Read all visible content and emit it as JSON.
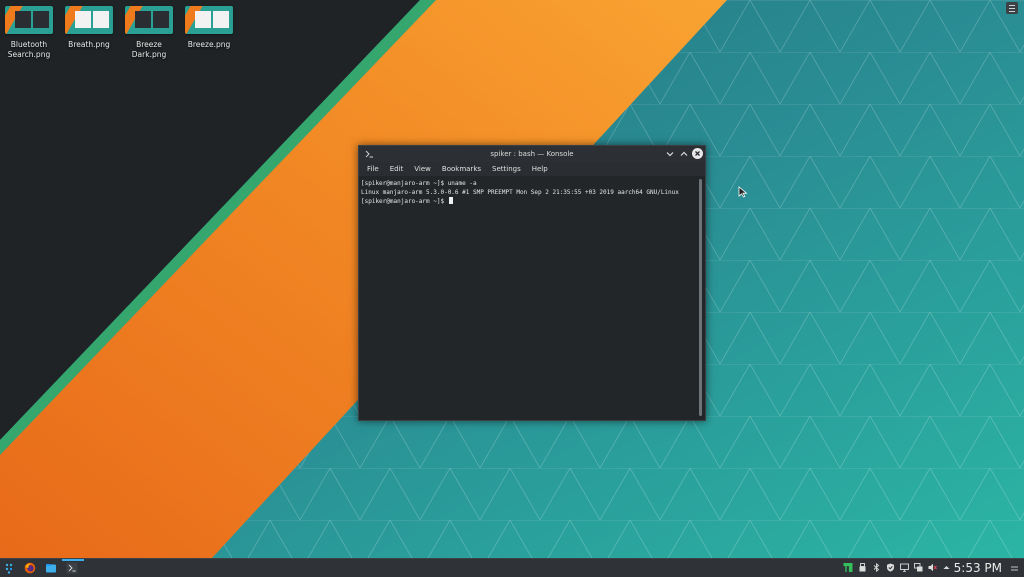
{
  "desktop": {
    "icons": [
      {
        "label": "Bluetooth Search.png"
      },
      {
        "label": "Breath.png"
      },
      {
        "label": "Breeze Dark.png"
      },
      {
        "label": "Breeze.png"
      }
    ]
  },
  "window": {
    "title": "spiker : bash — Konsole",
    "menu": [
      "File",
      "Edit",
      "View",
      "Bookmarks",
      "Settings",
      "Help"
    ],
    "terminal": {
      "lines": [
        "[spiker@manjaro-arm ~]$ uname -a",
        "Linux manjaro-arm 5.3.0-0.6 #1 SMP PREEMPT Mon Sep 2 21:35:55 +03 2019 aarch64 GNU/Linux",
        "[spiker@manjaro-arm ~]$ "
      ]
    }
  },
  "taskbar": {
    "clock": "5:53 PM"
  },
  "colors": {
    "accent_teal": "#2aa198",
    "orange": "#f07b1d",
    "green_stripe": "#35a66e"
  }
}
